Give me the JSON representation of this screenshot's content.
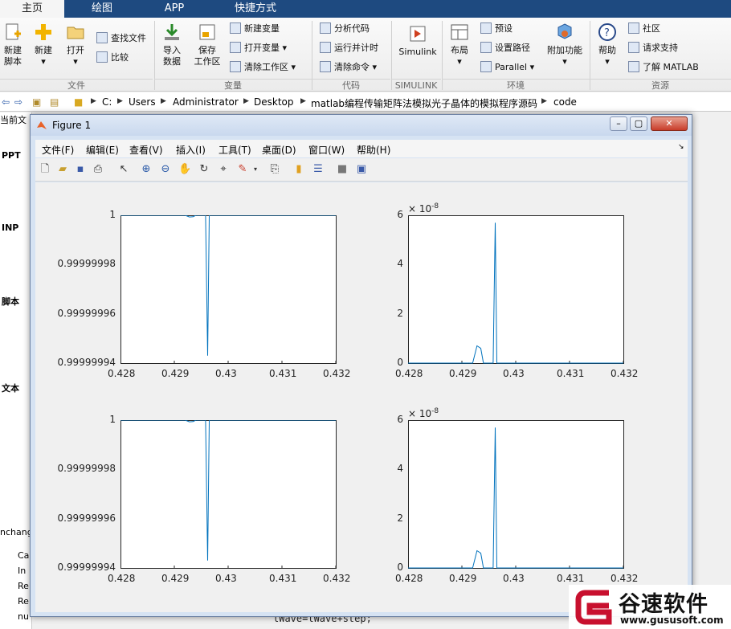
{
  "tabs": [
    "主页",
    "绘图",
    "APP",
    "快捷方式"
  ],
  "ribbon": {
    "file": {
      "new_script": "新建\n脚本",
      "new": "新建",
      "open": "打开",
      "find_files": "查找文件",
      "compare": "比较",
      "group": "文件"
    },
    "variable": {
      "import": "导入\n数据",
      "save_ws": "保存\n工作区",
      "new_var": "新建变量",
      "open_var": "打开变量",
      "clear_ws": "清除工作区",
      "group": "变量"
    },
    "code": {
      "analyze": "分析代码",
      "run_time": "运行并计时",
      "clear_cmd": "清除命令",
      "group": "代码"
    },
    "simulink": {
      "label": "Simulink",
      "group": "SIMULINK"
    },
    "env": {
      "layout": "布局",
      "prefs": "预设",
      "set_path": "设置路径",
      "parallel": "Parallel",
      "addons": "附加功能",
      "group": "环境"
    },
    "resources": {
      "help": "帮助",
      "community": "社区",
      "support": "请求支持",
      "learn": "了解 MATLAB",
      "group": "资源"
    }
  },
  "address": {
    "path": [
      "C:",
      "Users",
      "Administrator",
      "Desktop",
      "matlab编程传输矩阵法模拟光子晶体的模拟程序源码",
      "code"
    ]
  },
  "left_pane": {
    "items": [
      "当前文",
      "PPT",
      "INP",
      "脚本",
      "文本",
      "nchang",
      "Ca",
      "In",
      "Re",
      "Re",
      "nu"
    ]
  },
  "bottom_code": "lWave=lWave+step;",
  "figure": {
    "title": "Figure 1",
    "menu": [
      "文件(F)",
      "编辑(E)",
      "查看(V)",
      "插入(I)",
      "工具(T)",
      "桌面(D)",
      "窗口(W)",
      "帮助(H)"
    ]
  },
  "chart_data": [
    {
      "type": "line",
      "x": [
        0.428,
        0.4292,
        0.42928,
        0.42935,
        0.4294,
        0.42958,
        0.42962,
        0.42965,
        0.4297,
        0.432
      ],
      "y": [
        1,
        1,
        0.9999999993,
        0.9999999994,
        1,
        1,
        0.999999943,
        1,
        1,
        1
      ],
      "xlim": [
        0.428,
        0.432
      ],
      "ylim": [
        0.99999994,
        1
      ],
      "xticks": [
        "0.428",
        "0.429",
        "0.43",
        "0.431",
        "0.432"
      ],
      "yticks": [
        "1",
        "0.99999998",
        "0.99999996",
        "0.99999994"
      ],
      "title": "",
      "xlabel": "",
      "ylabel": "",
      "exponent": "",
      "color": "#0072bd"
    },
    {
      "type": "line",
      "x": [
        0.428,
        0.4292,
        0.42928,
        0.42935,
        0.4294,
        0.42958,
        0.42962,
        0.42965,
        0.4297,
        0.432
      ],
      "y": [
        0,
        0,
        0.7,
        0.6,
        0,
        0,
        5.7,
        0,
        0,
        0
      ],
      "xlim": [
        0.428,
        0.432
      ],
      "ylim": [
        0,
        6
      ],
      "xticks": [
        "0.428",
        "0.429",
        "0.43",
        "0.431",
        "0.432"
      ],
      "yticks": [
        "6",
        "4",
        "2",
        "0"
      ],
      "title": "",
      "xlabel": "",
      "ylabel": "",
      "exponent": "× 10",
      "exponent_power": "-8",
      "color": "#0072bd"
    },
    {
      "type": "line",
      "x": [
        0.428,
        0.4292,
        0.42928,
        0.42935,
        0.4294,
        0.42958,
        0.42962,
        0.42965,
        0.4297,
        0.432
      ],
      "y": [
        1,
        1,
        0.9999999993,
        0.9999999994,
        1,
        1,
        0.999999943,
        1,
        1,
        1
      ],
      "xlim": [
        0.428,
        0.432
      ],
      "ylim": [
        0.99999994,
        1
      ],
      "xticks": [
        "0.428",
        "0.429",
        "0.43",
        "0.431",
        "0.432"
      ],
      "yticks": [
        "1",
        "0.99999998",
        "0.99999996",
        "0.99999994"
      ],
      "title": "",
      "xlabel": "",
      "ylabel": "",
      "exponent": "",
      "color": "#0072bd"
    },
    {
      "type": "line",
      "x": [
        0.428,
        0.4292,
        0.42928,
        0.42935,
        0.4294,
        0.42958,
        0.42962,
        0.42965,
        0.4297,
        0.432
      ],
      "y": [
        0,
        0,
        0.7,
        0.6,
        0,
        0,
        5.7,
        0,
        0,
        0
      ],
      "xlim": [
        0.428,
        0.432
      ],
      "ylim": [
        0,
        6
      ],
      "xticks": [
        "0.428",
        "0.429",
        "0.43",
        "0.431",
        "0.432"
      ],
      "yticks": [
        "6",
        "4",
        "2",
        "0"
      ],
      "title": "",
      "xlabel": "",
      "ylabel": "",
      "exponent": "× 10",
      "exponent_power": "-8",
      "color": "#0072bd"
    }
  ],
  "watermark": {
    "brand": "谷速软件",
    "url": "www.gususoft.com",
    "color": "#c8102e"
  }
}
